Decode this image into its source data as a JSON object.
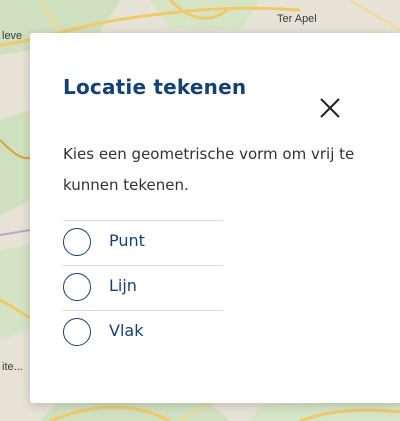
{
  "map": {
    "labels": [
      "leve",
      "Ter Apel",
      "ite..."
    ]
  },
  "dialog": {
    "title": "Locatie tekenen",
    "close_icon": "close-icon",
    "description": "Kies een geometrische vorm om vrij te kunnen tekenen.",
    "options": [
      {
        "label": "Punt",
        "selected": false
      },
      {
        "label": "Lijn",
        "selected": false
      },
      {
        "label": "Vlak",
        "selected": false
      }
    ]
  },
  "colors": {
    "primary": "#154273",
    "text": "#333333",
    "divider": "#d9d9d9"
  }
}
